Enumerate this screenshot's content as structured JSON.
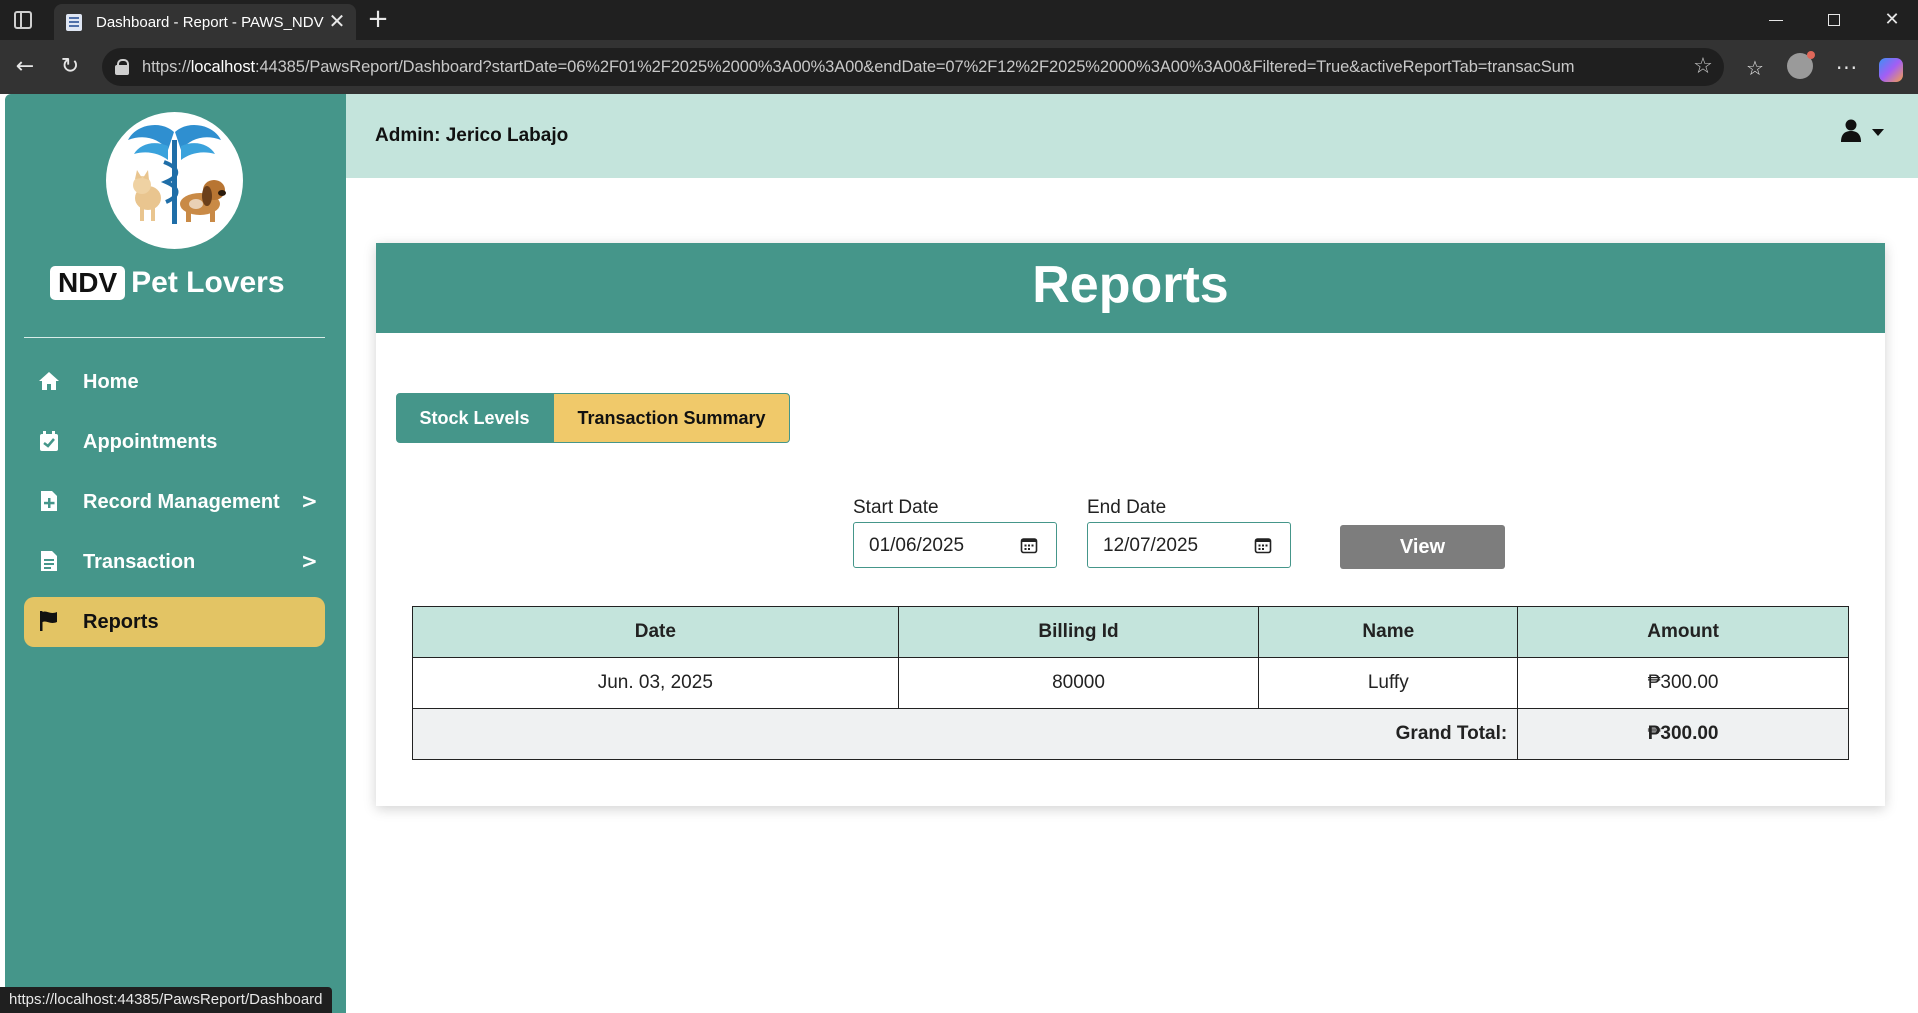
{
  "browser": {
    "tab_title": "Dashboard - Report - PAWS_NDV",
    "tab_close": "✕",
    "new_tab": "+",
    "url_scheme": "https://",
    "url_host": "localhost",
    "url_rest": ":44385/PawsReport/Dashboard?startDate=06%2F01%2F2025%2000%3A00%3A00&endDate=07%2F12%2F2025%2000%3A00%3A00&Filtered=True&activeReportTab=transacSum",
    "status_link": "https://localhost:44385/PawsReport/Dashboard"
  },
  "sidebar": {
    "brand_badge": "NDV",
    "brand_name": "Pet Lovers",
    "items": [
      {
        "label": "Home",
        "icon": "home-icon",
        "arrow": ""
      },
      {
        "label": "Appointments",
        "icon": "calendar-check-icon",
        "arrow": ""
      },
      {
        "label": "Record Management",
        "icon": "file-plus-icon",
        "arrow": ">"
      },
      {
        "label": "Transaction",
        "icon": "file-text-icon",
        "arrow": ">"
      },
      {
        "label": "Reports",
        "icon": "flag-icon",
        "arrow": ""
      }
    ],
    "active_index": 4
  },
  "topbar": {
    "admin_text": "Admin: Jerico Labajo"
  },
  "report": {
    "title": "Reports",
    "tabs": {
      "stock": "Stock Levels",
      "transaction": "Transaction Summary",
      "active": "transaction"
    },
    "filters": {
      "start_label": "Start Date",
      "start_value": "01/06/2025",
      "end_label": "End Date",
      "end_value": "12/07/2025",
      "view_label": "View"
    },
    "table": {
      "headers": [
        "Date",
        "Billing Id",
        "Name",
        "Amount"
      ],
      "rows": [
        [
          "Jun. 03, 2025",
          "80000",
          "Luffy",
          "₱300.00"
        ]
      ],
      "total_label": "Grand Total:",
      "total_value": "₱300.00"
    }
  },
  "colors": {
    "teal": "#45968a",
    "mint": "#c4e4dc",
    "gold": "#e3c464",
    "tab_gold": "#f0c96a"
  }
}
